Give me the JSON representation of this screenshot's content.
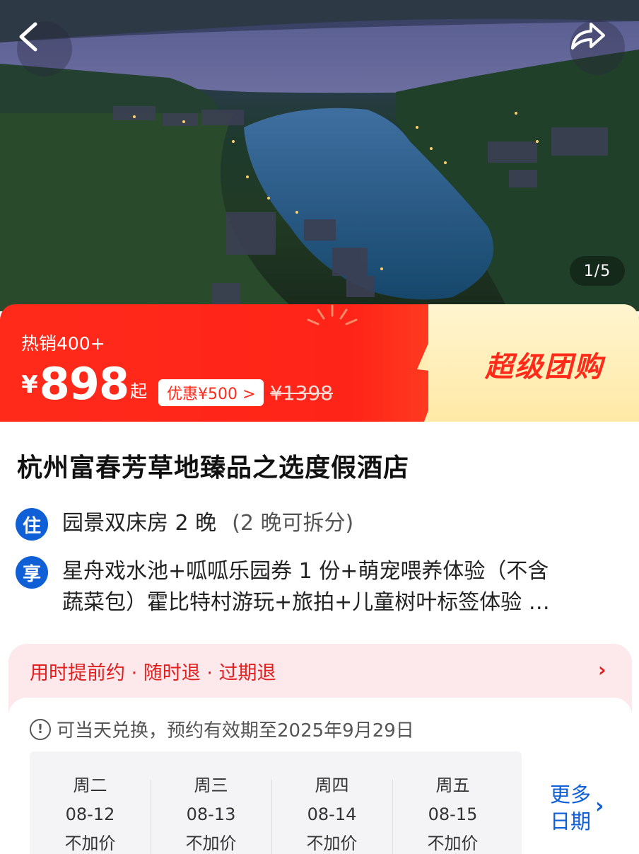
{
  "gallery": {
    "back_icon": "chevron-left-icon",
    "share_icon": "share-arrow-icon",
    "counter": "1/5"
  },
  "banner": {
    "hot_sale": "热销400+",
    "currency": "¥",
    "price": "898",
    "price_suffix": "起",
    "discount": "优惠¥500 >",
    "original_price": "¥1398",
    "promo": "超级团购",
    "colors": {
      "red": "#ff2a1a",
      "yellow": "#ffe9a6"
    }
  },
  "hotel": {
    "name": "杭州富春芳草地臻品之选度假酒店",
    "room_badge": "住",
    "room": "园景双床房 2 晚",
    "room_note": "(2 晚可拆分)",
    "perk_badge": "享",
    "perks_line1": "星舟戏水池+呱呱乐园券 1 份+萌宠喂养体验（不含",
    "perks_line2": "蔬菜包）霍比特村游玩+旅拍+儿童树叶标签体验 …"
  },
  "booking": {
    "policy": "用时提前约 · 随时退 · 过期退",
    "validity": "可当天兑换，预约有效期至2025年9月29日",
    "dates": [
      {
        "weekday": "周二",
        "date": "08-12",
        "price": "不加价"
      },
      {
        "weekday": "周三",
        "date": "08-13",
        "price": "不加价"
      },
      {
        "weekday": "周四",
        "date": "08-14",
        "price": "不加价"
      },
      {
        "weekday": "周五",
        "date": "08-15",
        "price": "不加价"
      }
    ],
    "more_line1": "更多",
    "more_line2": "日期",
    "accent": "#0f5fd6"
  }
}
